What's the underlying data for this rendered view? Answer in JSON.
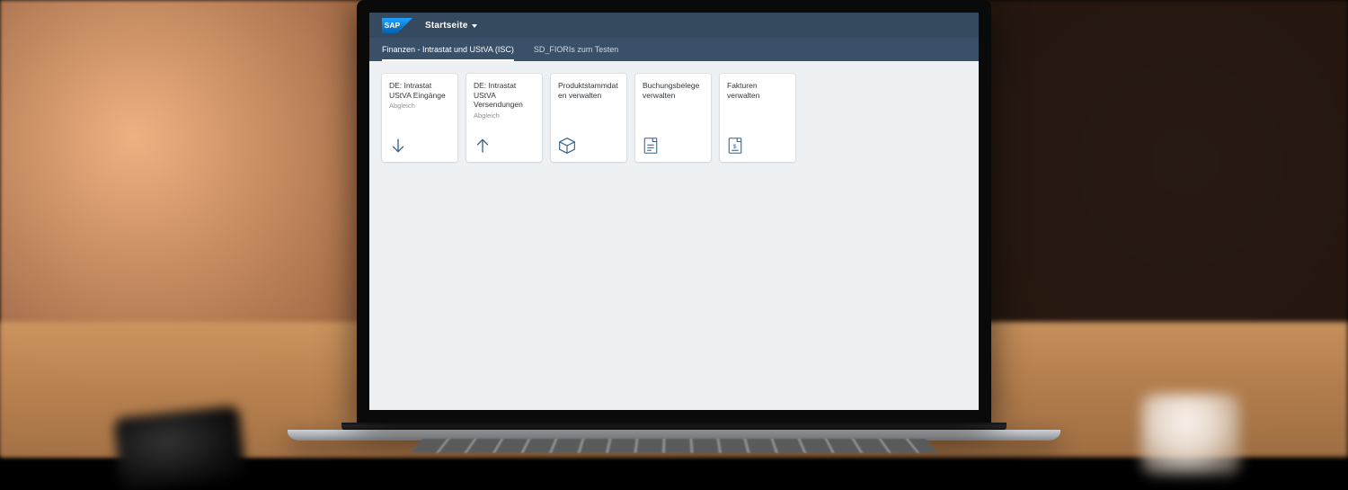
{
  "brand": "SAP",
  "shell_title": "Startseite",
  "tabs": [
    {
      "label": "Finanzen - Intrastat und UStVA (ISC)",
      "active": true
    },
    {
      "label": "SD_FIORIs zum Testen",
      "active": false
    }
  ],
  "tiles": [
    {
      "title": "DE: Intrastat UStVA Eingänge",
      "subtitle": "Abgleich",
      "icon": "arrow-down-icon"
    },
    {
      "title": "DE: Intrastat UStVA Versendungen",
      "subtitle": "Abgleich",
      "icon": "arrow-up-icon"
    },
    {
      "title": "Produktstammdaten verwalten",
      "subtitle": "",
      "icon": "cube-icon"
    },
    {
      "title": "Buchungsbelege verwalten",
      "subtitle": "",
      "icon": "document-list-icon"
    },
    {
      "title": "Fakturen verwalten",
      "subtitle": "",
      "icon": "invoice-icon"
    }
  ],
  "colors": {
    "shellbar": "#354a5f",
    "tabbar": "#3a5068",
    "tile_icon": "#346187",
    "page_bg": "#eef1f4"
  }
}
